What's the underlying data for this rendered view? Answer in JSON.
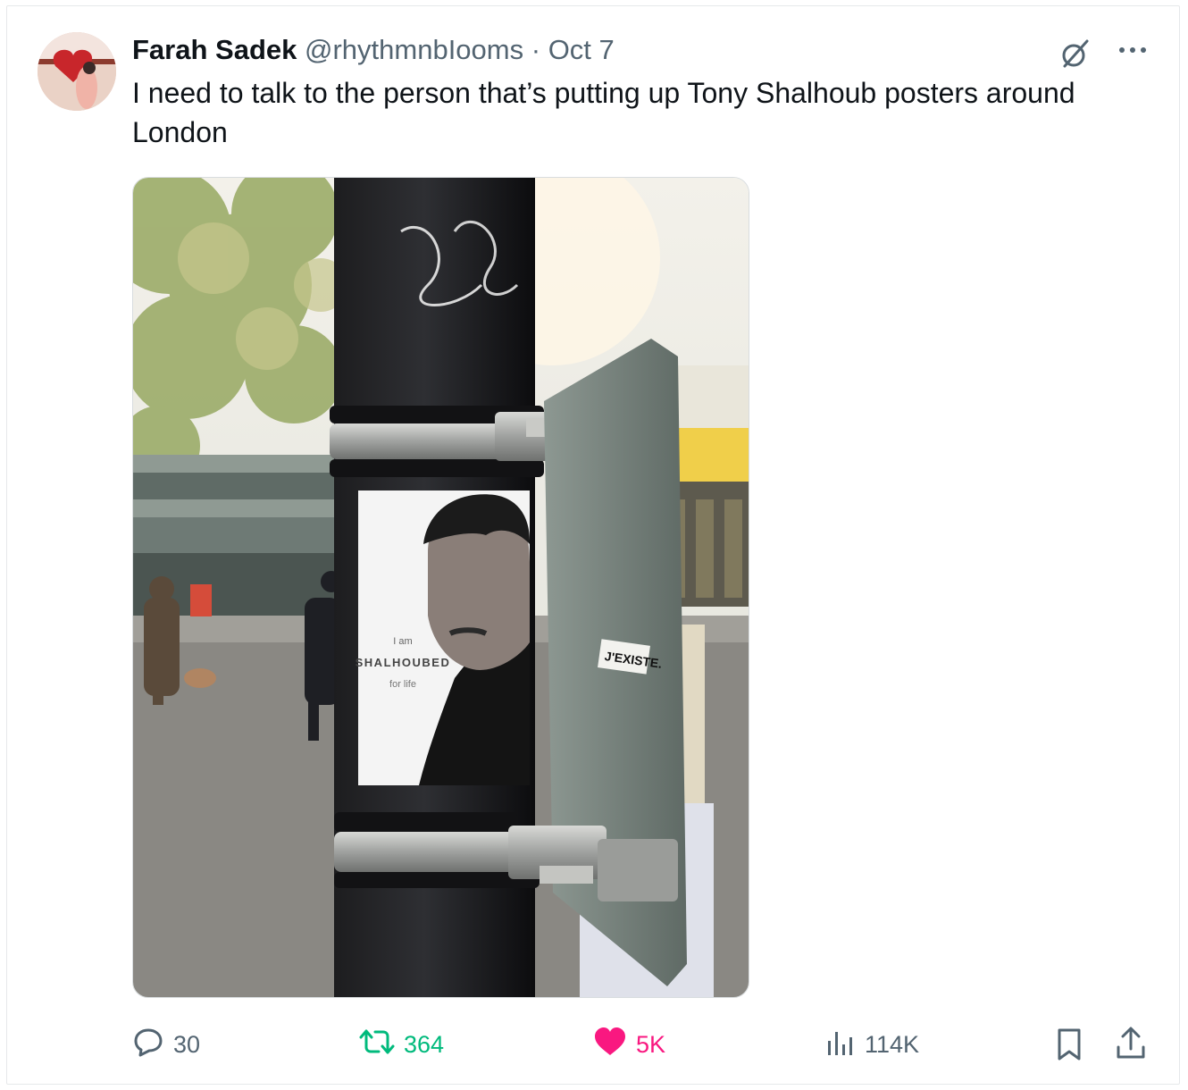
{
  "tweet": {
    "author_name": "Farah Sadek",
    "handle": "@rhythmnbIooms",
    "separator": "·",
    "date": "Oct 7",
    "text": "I need to talk to the person that’s putting up Tony Shalhoub posters around London"
  },
  "poster": {
    "line1": "I am",
    "line2": "SHALHOUBED",
    "line3": "for life"
  },
  "sticker": {
    "text": "J'EXISTE."
  },
  "stats": {
    "replies": "30",
    "retweets": "364",
    "likes": "5K",
    "views": "114K"
  },
  "icons": {
    "grok": "grok-slash-icon",
    "more": "more-dots-icon",
    "reply": "reply-bubble-icon",
    "retweet": "retweet-arrows-icon",
    "like": "heart-icon",
    "views": "bar-chart-icon",
    "bookmark": "bookmark-icon",
    "share": "share-icon"
  },
  "colors": {
    "text": "#0f1419",
    "muted": "#536471",
    "retweet_active": "#00ba7c",
    "like_active": "#f91880"
  }
}
